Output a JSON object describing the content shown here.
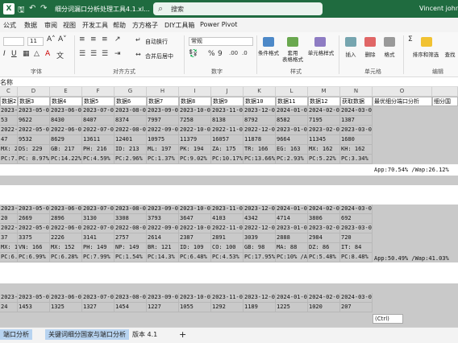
{
  "titlebar": {
    "logo": "X",
    "doc_title": "细分词漏口分析处理工具4.1.xl...",
    "search_placeholder": "搜索",
    "user": "Vincent johns"
  },
  "menu": [
    "公式",
    "数据",
    "审阅",
    "视图",
    "开发工具",
    "帮助",
    "方方格子",
    "DIY工具箱",
    "Power Pivot"
  ],
  "ribbon": {
    "font_size": "11",
    "wrap_text": "自动换行",
    "merge_center": "合并后居中",
    "number_format": "常规",
    "conditional_format": "条件格式",
    "table_format": "套用\n表格格式",
    "cell_style": "单元格样式",
    "insert": "插入",
    "delete": "删除",
    "format": "格式",
    "sort_filter": "排序和筛选",
    "find_select": "查找",
    "groups": [
      "字体",
      "对齐方式",
      "数字",
      "样式",
      "单元格",
      "编辑"
    ]
  },
  "formula": {
    "name_box": "名称"
  },
  "columns": [
    "C",
    "D",
    "E",
    "F",
    "G",
    "H",
    "I",
    "J",
    "K",
    "L",
    "M",
    "N",
    "O"
  ],
  "header_row": [
    "数据2",
    "数据3",
    "数据4",
    "数据5",
    "数据6",
    "数据7",
    "数据8",
    "数据9",
    "数据10",
    "数据11",
    "数据12",
    "获取数据",
    "最优细分端口分析",
    "细分国"
  ],
  "block1": {
    "r1": [
      "2023-04-01",
      "2023-05-01",
      "2023-06-01",
      "2023-07-01",
      "2023-08-01",
      "2023-09-01",
      "2023-10-01",
      "2023-11-01",
      "2023-12-01",
      "2024-01-01",
      "2024-02-01",
      "2024-03-01"
    ],
    "r2": [
      "53",
      "9622",
      "8430",
      "8407",
      "8374",
      "7997",
      "7258",
      "8138",
      "8792",
      "8582",
      "7195",
      "1387"
    ],
    "r3": [
      "2022-04-01",
      "2022-05-01",
      "2022-06-01",
      "2022-07-01",
      "2022-08-01",
      "2022-09-01",
      "2022-10-01",
      "2022-11-01",
      "2022-12-01",
      "2023-01-01",
      "2023-02-01",
      "2023-03-01"
    ],
    "r4": [
      "47",
      "9532",
      "8629",
      "13611",
      "12401",
      "10975",
      "11379",
      "16057",
      "11878",
      "9664",
      "11345",
      "1680"
    ],
    "r5": [
      "MX: 216",
      "DS: 229",
      "GB: 217",
      "PH: 216",
      "ID: 213",
      "ML: 197",
      "PK: 194",
      "ZA: 175",
      "TR: 166",
      "EG: 163",
      "MX: 162",
      "KH: 162"
    ],
    "r6": [
      "PC:7.81%",
      "PC: 8.97%",
      "PC:14.22%",
      "PC:4.59%",
      "PC:2.96%",
      "PC:1.37%",
      "PC:9.02%",
      "PC:10.17%",
      "PC:13.66%",
      "PC:2.93%",
      "PC:5.22%",
      "PC:3.34%"
    ],
    "analysis": "App:70.54% /Wap:26.12%"
  },
  "block2": {
    "r1": [
      "2023-04-01",
      "2023-05-01",
      "2023-06-01",
      "2023-07-01",
      "2023-08-01",
      "2023-09-01",
      "2023-10-01",
      "2023-11-01",
      "2023-12-01",
      "2024-01-01",
      "2024-02-01",
      "2024-03-01"
    ],
    "r2": [
      "20",
      "2669",
      "2896",
      "3130",
      "3308",
      "3793",
      "3647",
      "4103",
      "4342",
      "4714",
      "3806",
      "692"
    ],
    "r3": [
      "2022-04-01",
      "2022-05-01",
      "2022-06-01",
      "2022-07-01",
      "2022-08-01",
      "2022-09-01",
      "2022-10-01",
      "2022-11-01",
      "2022-12-01",
      "2023-01-01",
      "2023-02-01",
      "2023-03-01"
    ],
    "r4": [
      "37",
      "3375",
      "2226",
      "3141",
      "2757",
      "2614",
      "2387",
      "2891",
      "3039",
      "2888",
      "2984",
      "720"
    ],
    "r5": [
      "MX: 176",
      "VN: 166",
      "MX: 152",
      "PH: 149",
      "NP: 149",
      "BR: 121",
      "ID: 109",
      "CO: 100",
      "GB: 98",
      "MA: 88",
      "DZ: 86",
      "IT: 84"
    ],
    "r6": [
      "PC:6.86%",
      "PC:6.99%",
      "PC:6.28%",
      "PC:7.99%",
      "PC:1.54%",
      "PC:14.3%",
      "PC:6.48%",
      "PC:4.53%",
      "PC:17.95%",
      "PC:10% /Ap",
      "PC:5.48%",
      "PC:8.48%"
    ],
    "analysis": "App:50.49% /Wap:41.03%"
  },
  "block3": {
    "r1": [
      "2023-04-01",
      "2023-05-01",
      "2023-06-01",
      "2023-07-01",
      "2023-08-01",
      "2023-09-01",
      "2023-10-01",
      "2023-11-01",
      "2023-12-01",
      "2024-01-01",
      "2024-02-01",
      "2024-03-01"
    ],
    "r2": [
      "24",
      "1453",
      "1325",
      "1327",
      "1454",
      "1227",
      "1055",
      "1292",
      "1189",
      "1225",
      "1020",
      "207"
    ]
  },
  "sheets": [
    "端口分析",
    "关键词细分国家与端口分析",
    "版本 4.1"
  ],
  "paste_tag": "(Ctrl)"
}
